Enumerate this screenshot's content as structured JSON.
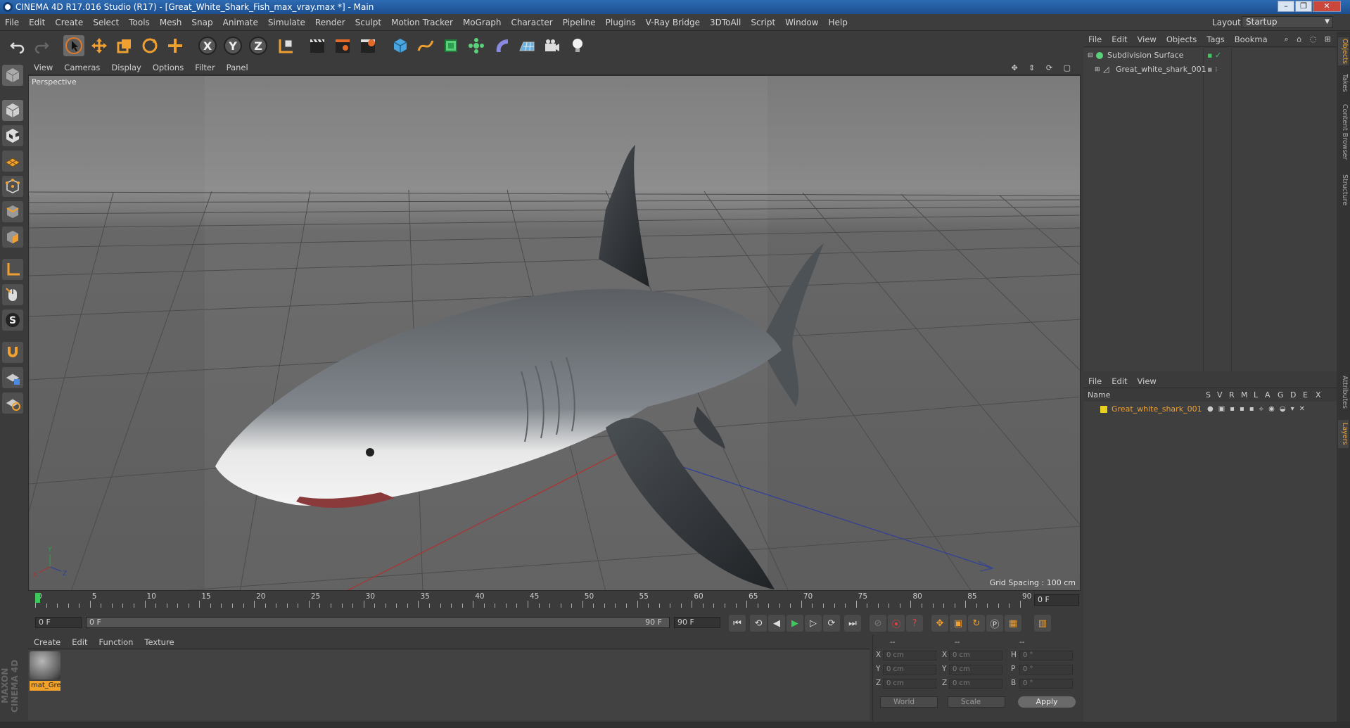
{
  "window": {
    "title": "CINEMA 4D R17.016 Studio (R17) - [Great_White_Shark_Fish_max_vray.max *] - Main",
    "min": "–",
    "max": "❐",
    "close": "✕"
  },
  "menubar": {
    "items": [
      "File",
      "Edit",
      "Create",
      "Select",
      "Tools",
      "Mesh",
      "Snap",
      "Animate",
      "Simulate",
      "Render",
      "Sculpt",
      "Motion Tracker",
      "MoGraph",
      "Character",
      "Pipeline",
      "Plugins",
      "V-Ray Bridge",
      "3DToAll",
      "Script",
      "Window",
      "Help"
    ],
    "layout_label": "Layout:",
    "layout_value": "Startup"
  },
  "viewport": {
    "menu": [
      "View",
      "Cameras",
      "Display",
      "Options",
      "Filter",
      "Panel"
    ],
    "camera_label": "Perspective",
    "grid_spacing": "Grid Spacing : 100 cm",
    "axis_labels": {
      "x": "X",
      "y": "Y",
      "z": "Z"
    }
  },
  "timeline": {
    "ticks": [
      "0",
      "5",
      "10",
      "15",
      "20",
      "25",
      "30",
      "35",
      "40",
      "45",
      "50",
      "55",
      "60",
      "65",
      "70",
      "75",
      "80",
      "85",
      "90"
    ],
    "current_frame_box": "0 F"
  },
  "playbar": {
    "start_field": "0 F",
    "slider_start": "0 F",
    "slider_end": "90 F",
    "end_field": "90 F"
  },
  "material_manager": {
    "menu": [
      "Create",
      "Edit",
      "Function",
      "Texture"
    ],
    "material_name": "mat_Gre"
  },
  "coordinates": {
    "col_headers": [
      "--",
      "--",
      "--"
    ],
    "rows": [
      {
        "a": "X",
        "a_val": "0 cm",
        "b": "X",
        "b_val": "0 cm",
        "c": "H",
        "c_val": "0 °"
      },
      {
        "a": "Y",
        "a_val": "0 cm",
        "b": "Y",
        "b_val": "0 cm",
        "c": "P",
        "c_val": "0 °"
      },
      {
        "a": "Z",
        "a_val": "0 cm",
        "b": "Z",
        "b_val": "0 cm",
        "c": "B",
        "c_val": "0 °"
      }
    ],
    "world_dropdown": "World",
    "scale_dropdown": "Scale",
    "apply": "Apply"
  },
  "object_manager": {
    "menu": [
      "File",
      "Edit",
      "View",
      "Objects",
      "Tags",
      "Bookma"
    ],
    "objects": [
      "Subdivision Surface",
      "Great_white_shark_001"
    ]
  },
  "layer_manager": {
    "menu": [
      "File",
      "Edit",
      "View"
    ],
    "columns": [
      "Name",
      "S",
      "V",
      "R",
      "M",
      "L",
      "A",
      "G",
      "D",
      "E",
      "X"
    ],
    "layers": [
      "Great_white_shark_001"
    ]
  },
  "right_tabs": [
    "Objects",
    "Takes",
    "Content Browser",
    "Structure",
    "Attributes",
    "Layers"
  ],
  "brand": "MAXON CINEMA 4D"
}
